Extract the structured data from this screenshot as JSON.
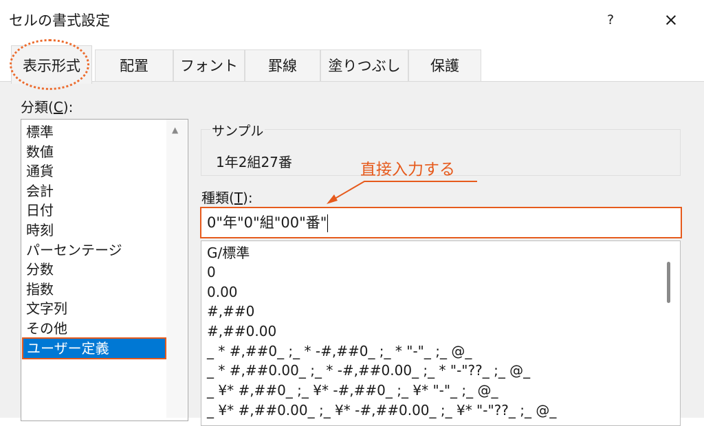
{
  "window": {
    "title": "セルの書式設定",
    "help": "?",
    "close": "×"
  },
  "tabs": [
    {
      "label": "表示形式",
      "active": true
    },
    {
      "label": "配置"
    },
    {
      "label": "フォント"
    },
    {
      "label": "罫線"
    },
    {
      "label": "塗りつぶし"
    },
    {
      "label": "保護"
    }
  ],
  "category": {
    "label_prefix": "分類(",
    "label_key": "C",
    "label_suffix": "):",
    "items": [
      "標準",
      "数値",
      "通貨",
      "会計",
      "日付",
      "時刻",
      "パーセンテージ",
      "分数",
      "指数",
      "文字列",
      "その他",
      "ユーザー定義"
    ],
    "selected": "ユーザー定義"
  },
  "sample": {
    "label": "サンプル",
    "value": "1年2組27番"
  },
  "annotation": {
    "text": "直接入力する",
    "color": "#e65a1c"
  },
  "type": {
    "label_prefix": "種類(",
    "label_key": "T",
    "label_suffix": "):",
    "value": "0\"年\"0\"組\"00\"番\""
  },
  "formats": [
    "G/標準",
    "0",
    "0.00",
    "#,##0",
    "#,##0.00",
    "_ * #,##0_ ;_ * -#,##0_ ;_ * \"-\"_ ;_ @_",
    "_ * #,##0.00_ ;_ * -#,##0.00_ ;_ * \"-\"??_ ;_ @_",
    "_ ¥* #,##0_ ;_ ¥* -#,##0_ ;_ ¥* \"-\"_ ;_ @_",
    "_ ¥* #,##0.00_ ;_ ¥* -#,##0.00_ ;_ ¥* \"-\"??_ ;_ @_"
  ],
  "colors": {
    "accent": "#e65a1c",
    "selection": "#0078d4"
  }
}
